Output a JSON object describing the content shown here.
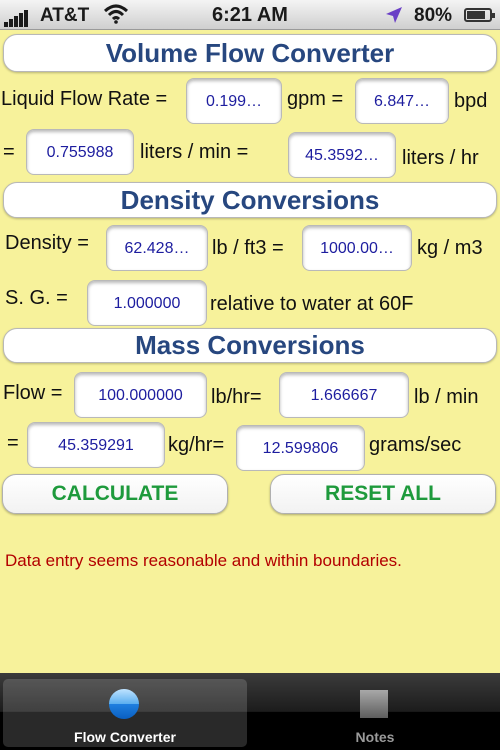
{
  "status_bar": {
    "carrier": "AT&T",
    "time": "6:21 AM",
    "battery": "80%",
    "battery_level": 0.8
  },
  "volume": {
    "title": "Volume Flow Converter",
    "liquid_flow_rate_label": "Liquid Flow Rate =",
    "gpm_value": "0.199…",
    "gpm_label": "gpm =",
    "bpd_value": "6.847…",
    "bpd_label": "bpd",
    "eq_label": "=",
    "lpm_value": "0.755988",
    "lpm_label": "liters / min =",
    "lph_value": "45.3592…",
    "lph_label": "liters / hr"
  },
  "density": {
    "title": "Density Conversions",
    "density_label": "Density =",
    "lbft3_value": "62.428…",
    "lbft3_label": "lb / ft3 =",
    "kgm3_value": "1000.00…",
    "kgm3_label": "kg / m3",
    "sg_label": "S. G. =",
    "sg_value": "1.000000",
    "sg_note": "relative to water at 60F"
  },
  "mass": {
    "title": "Mass Conversions",
    "flow_label": "Flow =",
    "lbhr_value": "100.000000",
    "lbhr_label": "lb/hr=",
    "lbmin_value": "1.666667",
    "lbmin_label": "lb / min",
    "eq_label": "=",
    "kghr_value": "45.359291",
    "kghr_label": "kg/hr=",
    "gs_value": "12.599806",
    "gs_label": "grams/sec"
  },
  "buttons": {
    "calculate": "CALCULATE",
    "reset": "RESET ALL"
  },
  "message": "Data entry seems reasonable and within boundaries.",
  "tabs": [
    {
      "label": "Flow Converter",
      "icon": "blue-orb-icon",
      "active": true
    },
    {
      "label": "Notes",
      "icon": "gray-square-icon",
      "active": false
    }
  ],
  "colors": {
    "background": "#f7f29b",
    "header_text": "#27477f",
    "field_text": "#1d1d9f",
    "button_text": "#1e9a3c",
    "message_text": "#b30000"
  }
}
